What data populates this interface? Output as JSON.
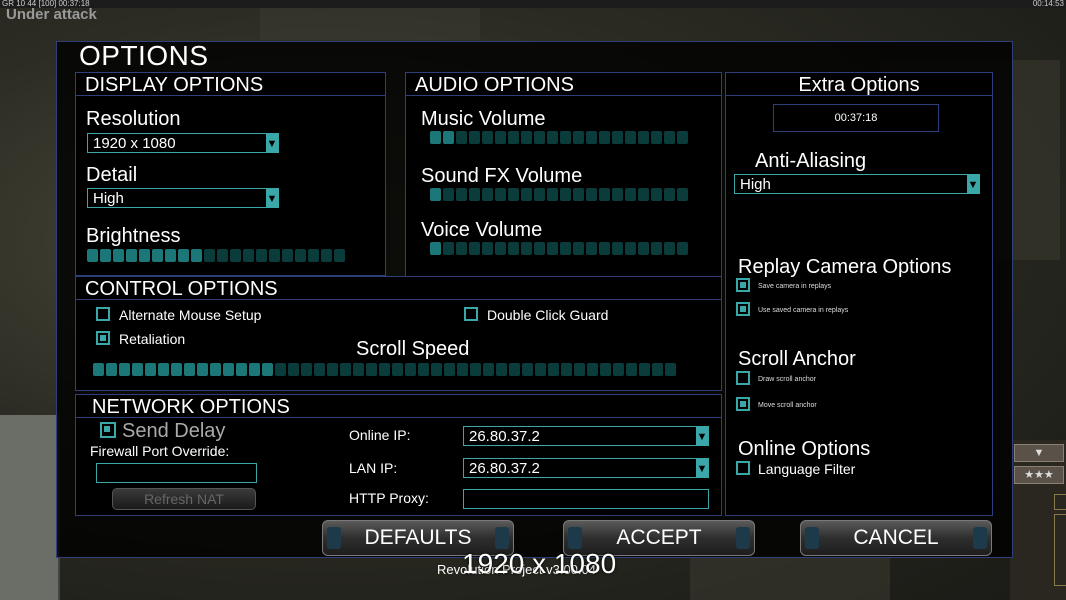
{
  "game_hud": {
    "top_left": "GR 10 44 [100] 00:37:18",
    "top_right": "00:14:53",
    "attack_text": "Under attack",
    "stars_button": "★★★",
    "down_button": "▼"
  },
  "dialog": {
    "title": "OPTIONS",
    "version": "Revolution Project v3.00.04",
    "resolution_overlay": "1920 x 1080"
  },
  "display": {
    "header": "DISPLAY OPTIONS",
    "resolution_label": "Resolution",
    "resolution_value": "1920 x 1080",
    "detail_label": "Detail",
    "detail_value": "High",
    "brightness_label": "Brightness",
    "brightness_level": 0.47
  },
  "audio": {
    "header": "AUDIO OPTIONS",
    "music_label": "Music Volume",
    "music_level": 0.1,
    "sfx_label": "Sound FX Volume",
    "sfx_level": 0.05,
    "voice_label": "Voice Volume",
    "voice_level": 0.05
  },
  "extra": {
    "header": "Extra Options",
    "time": "00:37:18",
    "aa_label": "Anti-Aliasing",
    "aa_value": "High",
    "replay_header": "Replay Camera Options",
    "save_camera": "Save camera in replays",
    "use_camera": "Use saved camera in replays",
    "scroll_anchor_header": "Scroll Anchor",
    "draw_anchor": "Draw scroll anchor",
    "move_anchor": "Move scroll anchor",
    "online_header": "Online Options",
    "language_filter": "Language Filter"
  },
  "control": {
    "header": "CONTROL OPTIONS",
    "alt_mouse": "Alternate Mouse Setup",
    "double_click": "Double Click Guard",
    "retaliation": "Retaliation",
    "scroll_speed_label": "Scroll Speed",
    "scroll_speed_level": 0.31
  },
  "network": {
    "header": "NETWORK OPTIONS",
    "send_delay": "Send Delay",
    "firewall_label": "Firewall Port Override:",
    "refresh_nat": "Refresh NAT",
    "online_ip_label": "Online IP:",
    "online_ip_value": "26.80.37.2",
    "lan_ip_label": "LAN IP:",
    "lan_ip_value": "26.80.37.2",
    "http_proxy_label": "HTTP Proxy:"
  },
  "buttons": {
    "defaults": "DEFAULTS",
    "accept": "ACCEPT",
    "cancel": "CANCEL"
  },
  "colors": {
    "accent": "#3aa8a8",
    "border": "#2f3f7a",
    "slider_on": "#1c7878",
    "slider_off": "#0a3c3c"
  }
}
